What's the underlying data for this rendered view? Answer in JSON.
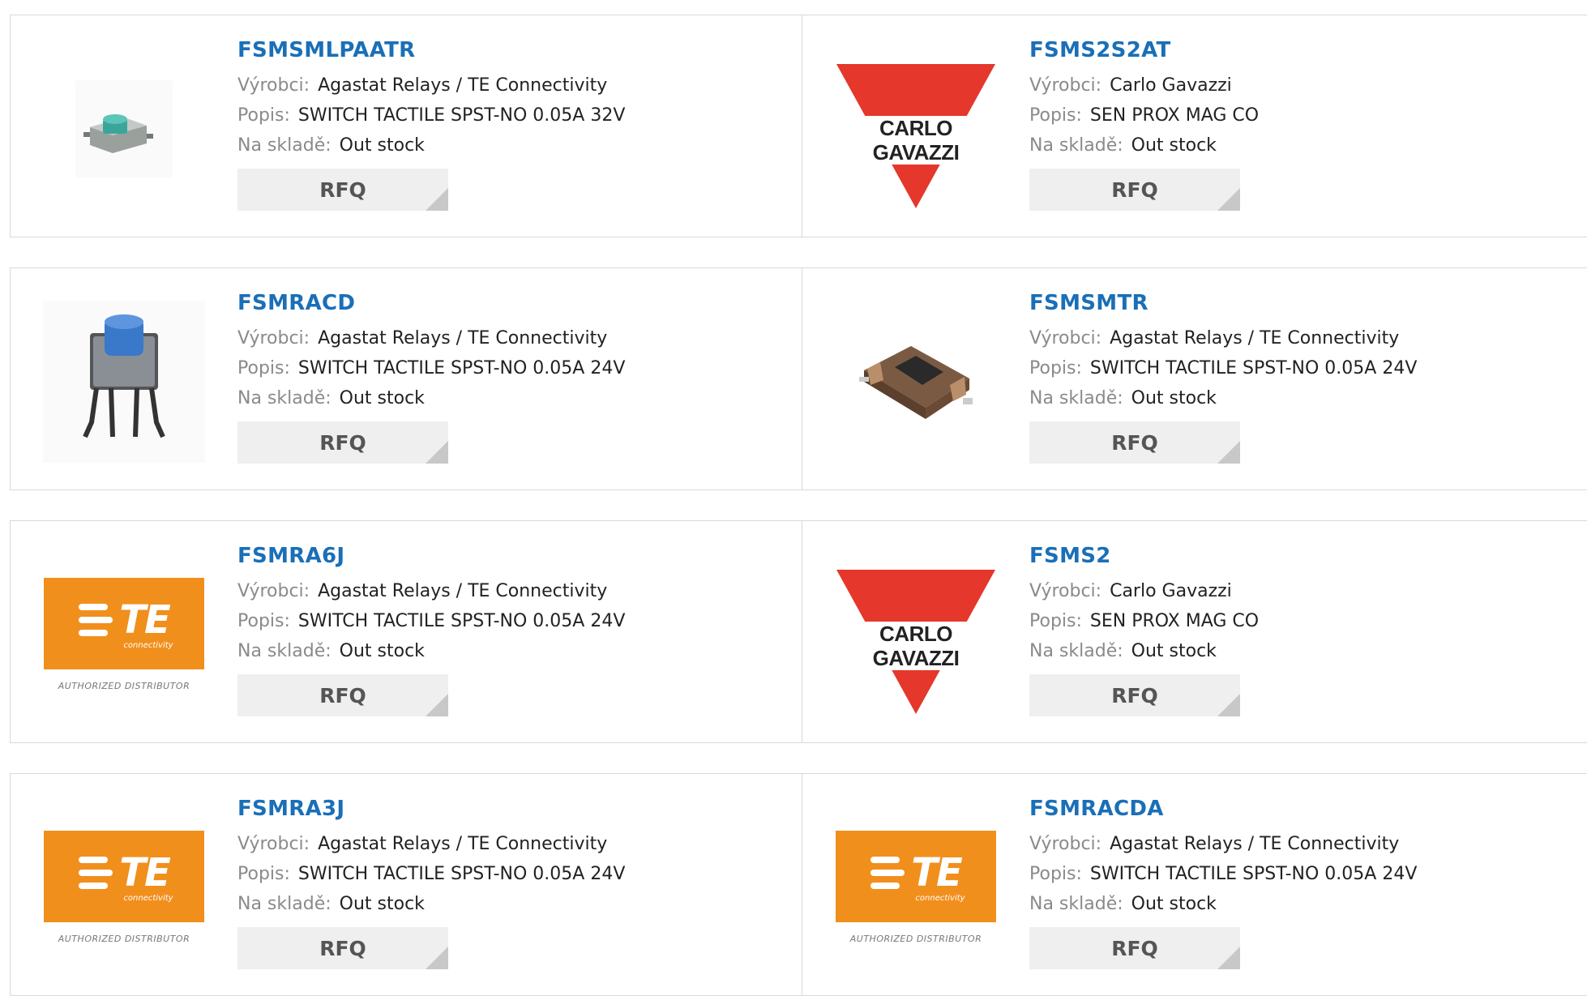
{
  "labels": {
    "manufacturer": "Výrobci:",
    "description": "Popis:",
    "stock": "Na skladě:",
    "rfq": "RFQ"
  },
  "brand": {
    "te_letters": "TE",
    "te_sub": "connectivity",
    "te_authorized": "AUTHORIZED DISTRIBUTOR",
    "cg_name": "CARLO GAVAZZI"
  },
  "colors": {
    "part_link": "#1a6fb7",
    "te_orange": "#f18f1d",
    "cg_red": "#e5372b"
  },
  "products": [
    {
      "part": "FSMSMLPAATR",
      "manufacturer": "Agastat Relays / TE Connectivity",
      "description": "SWITCH TACTILE SPST-NO 0.05A 32V",
      "stock": "Out stock",
      "image": "tactile-switch-green-icon"
    },
    {
      "part": "FSMS2S2AT",
      "manufacturer": "Carlo Gavazzi",
      "description": "SEN PROX MAG CO",
      "stock": "Out stock",
      "image": "carlo-gavazzi-logo"
    },
    {
      "part": "FSMRACD",
      "manufacturer": "Agastat Relays / TE Connectivity",
      "description": "SWITCH TACTILE SPST-NO 0.05A 24V",
      "stock": "Out stock",
      "image": "tactile-switch-blue-icon"
    },
    {
      "part": "FSMSMTR",
      "manufacturer": "Agastat Relays / TE Connectivity",
      "description": "SWITCH TACTILE SPST-NO 0.05A 24V",
      "stock": "Out stock",
      "image": "tactile-switch-smd-icon"
    },
    {
      "part": "FSMRA6J",
      "manufacturer": "Agastat Relays / TE Connectivity",
      "description": "SWITCH TACTILE SPST-NO 0.05A 24V",
      "stock": "Out stock",
      "image": "te-connectivity-logo"
    },
    {
      "part": "FSMS2",
      "manufacturer": "Carlo Gavazzi",
      "description": "SEN PROX MAG CO",
      "stock": "Out stock",
      "image": "carlo-gavazzi-logo"
    },
    {
      "part": "FSMRA3J",
      "manufacturer": "Agastat Relays / TE Connectivity",
      "description": "SWITCH TACTILE SPST-NO 0.05A 24V",
      "stock": "Out stock",
      "image": "te-connectivity-logo"
    },
    {
      "part": "FSMRACDA",
      "manufacturer": "Agastat Relays / TE Connectivity",
      "description": "SWITCH TACTILE SPST-NO 0.05A 24V",
      "stock": "Out stock",
      "image": "te-connectivity-logo"
    }
  ]
}
